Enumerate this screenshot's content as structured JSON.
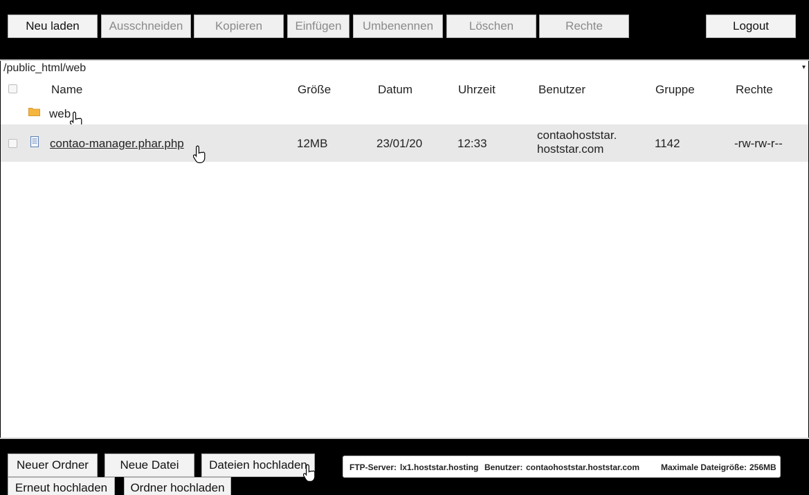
{
  "toolbar": {
    "reload": "Neu laden",
    "cut": "Ausschneiden",
    "copy": "Kopieren",
    "paste": "Einfügen",
    "rename": "Umbenennen",
    "delete": "Löschen",
    "permissions": "Rechte",
    "logout": "Logout"
  },
  "path": {
    "current": "/public_html/web",
    "caret": "▾"
  },
  "table": {
    "columns": [
      "Name",
      "Größe",
      "Datum",
      "Uhrzeit",
      "Benutzer",
      "Gruppe",
      "Rechte"
    ],
    "folder": {
      "name": "web",
      "icon": "folder-icon"
    },
    "file": {
      "name": "contao-manager.phar.php",
      "size": "12MB",
      "date": "23/01/20",
      "time": "12:33",
      "user_line1": "contaohoststar.",
      "user_line2": "hoststar.com",
      "group": "1142",
      "permissions": "-rw-rw-r--",
      "icon": "document-icon"
    }
  },
  "bottom": {
    "new_folder": "Neuer Ordner",
    "new_file": "Neue Datei",
    "upload_files": "Dateien hochladen",
    "reupload": "Erneut hochladen",
    "upload_folder": "Ordner hochladen"
  },
  "info": {
    "server_label": "FTP-Server:",
    "server_value": "lx1.hoststar.hosting",
    "user_label": "Benutzer:",
    "user_value": "contaohoststar.hoststar.com",
    "max_label": "Maximale Dateigröße:",
    "max_value": "256MB"
  },
  "colors": {
    "bar": "#000000",
    "selected_row": "#e8e8e8",
    "folder": "#f4b63f",
    "doc": "#5b7fb5"
  }
}
